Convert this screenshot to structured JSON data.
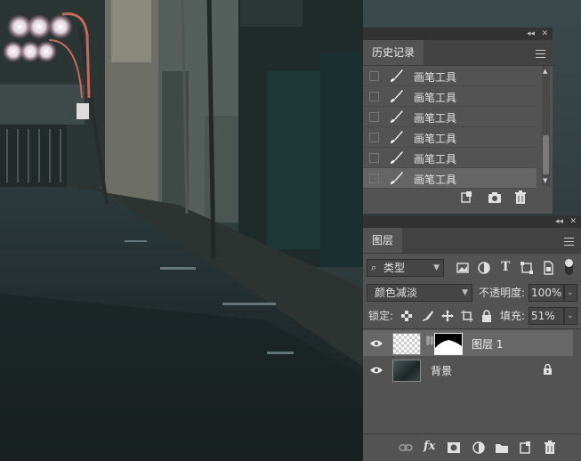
{
  "history_panel": {
    "title": "历史记录",
    "items": [
      {
        "label": "画笔工具",
        "selected": false
      },
      {
        "label": "画笔工具",
        "selected": false
      },
      {
        "label": "画笔工具",
        "selected": false
      },
      {
        "label": "画笔工具",
        "selected": false
      },
      {
        "label": "画笔工具",
        "selected": false
      },
      {
        "label": "画笔工具",
        "selected": true
      }
    ]
  },
  "layers_panel": {
    "title": "图层",
    "filter_label": "类型",
    "blend_mode": "颜色减淡",
    "opacity_label": "不透明度:",
    "opacity_value": "100%",
    "lock_label": "锁定:",
    "fill_label": "填充:",
    "fill_value": "51%",
    "layers": [
      {
        "name": "图层 1",
        "selected": true,
        "visible": true,
        "has_mask": true
      },
      {
        "name": "背景",
        "selected": false,
        "visible": true,
        "locked": true
      }
    ]
  },
  "colors": {
    "panel_bg": "#535353",
    "panel_dark": "#424242",
    "selected_row": "#676767"
  }
}
